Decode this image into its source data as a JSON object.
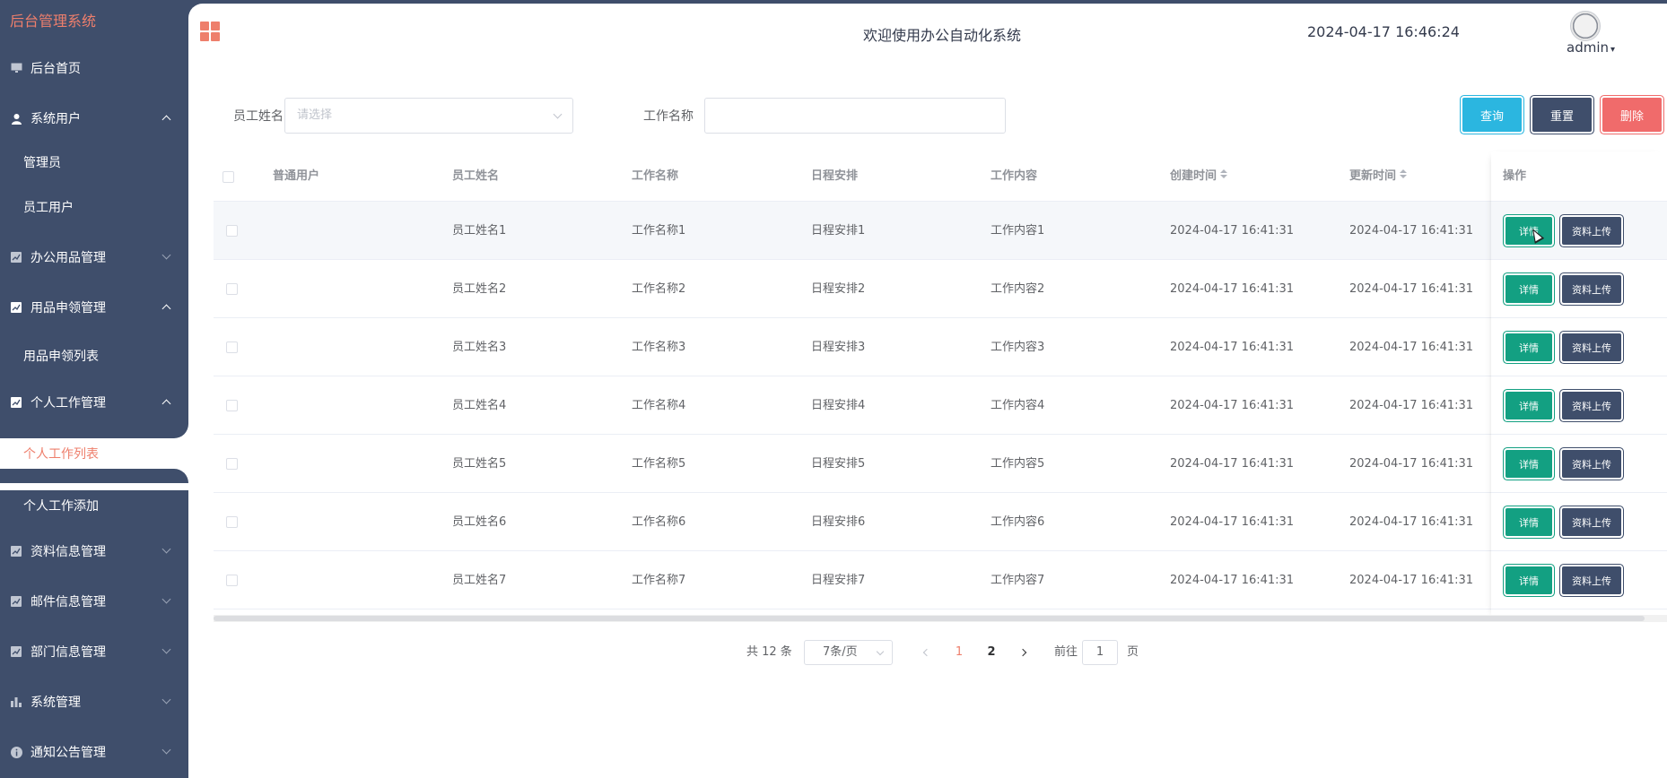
{
  "app": {
    "title": "后台管理系统"
  },
  "sidebar": {
    "items": [
      {
        "label": "后台首页",
        "icon": "monitor-icon"
      },
      {
        "label": "系统用户",
        "icon": "user-icon"
      },
      {
        "label": "管理员"
      },
      {
        "label": "员工用户"
      },
      {
        "label": "办公用品管理",
        "icon": "chart-icon"
      },
      {
        "label": "用品申领管理",
        "icon": "chart-icon"
      },
      {
        "label": "用品申领列表"
      },
      {
        "label": "个人工作管理",
        "icon": "chart-icon"
      },
      {
        "label": "个人工作列表"
      },
      {
        "label": "个人工作添加"
      },
      {
        "label": "资料信息管理",
        "icon": "chart-icon"
      },
      {
        "label": "邮件信息管理",
        "icon": "chart-icon"
      },
      {
        "label": "部门信息管理",
        "icon": "chart-icon"
      },
      {
        "label": "系统管理",
        "icon": "bar-chart-icon"
      },
      {
        "label": "通知公告管理",
        "icon": "info-icon"
      }
    ]
  },
  "header": {
    "welcome": "欢迎使用办公自动化系统",
    "datetime": "2024-04-17 16:46:24",
    "user": "admin"
  },
  "filters": {
    "employee_label": "员工姓名",
    "employee_placeholder": "请选择",
    "work_label": "工作名称",
    "work_value": "",
    "query_button": "查询",
    "reset_button": "重置",
    "delete_button": "删除"
  },
  "table": {
    "headers": [
      "普通用户",
      "员工姓名",
      "工作名称",
      "日程安排",
      "工作内容",
      "创建时间",
      "更新时间",
      "操作"
    ],
    "rows": [
      {
        "user": "",
        "name": "员工姓名1",
        "work": "工作名称1",
        "schedule": "日程安排1",
        "content": "工作内容1",
        "created": "2024-04-17 16:41:31",
        "updated": "2024-04-17 16:41:31"
      },
      {
        "user": "",
        "name": "员工姓名2",
        "work": "工作名称2",
        "schedule": "日程安排2",
        "content": "工作内容2",
        "created": "2024-04-17 16:41:31",
        "updated": "2024-04-17 16:41:31"
      },
      {
        "user": "",
        "name": "员工姓名3",
        "work": "工作名称3",
        "schedule": "日程安排3",
        "content": "工作内容3",
        "created": "2024-04-17 16:41:31",
        "updated": "2024-04-17 16:41:31"
      },
      {
        "user": "",
        "name": "员工姓名4",
        "work": "工作名称4",
        "schedule": "日程安排4",
        "content": "工作内容4",
        "created": "2024-04-17 16:41:31",
        "updated": "2024-04-17 16:41:31"
      },
      {
        "user": "",
        "name": "员工姓名5",
        "work": "工作名称5",
        "schedule": "日程安排5",
        "content": "工作内容5",
        "created": "2024-04-17 16:41:31",
        "updated": "2024-04-17 16:41:31"
      },
      {
        "user": "",
        "name": "员工姓名6",
        "work": "工作名称6",
        "schedule": "日程安排6",
        "content": "工作内容6",
        "created": "2024-04-17 16:41:31",
        "updated": "2024-04-17 16:41:31"
      },
      {
        "user": "",
        "name": "员工姓名7",
        "work": "工作名称7",
        "schedule": "日程安排7",
        "content": "工作内容7",
        "created": "2024-04-17 16:41:31",
        "updated": "2024-04-17 16:41:31"
      }
    ],
    "detail_button": "详情",
    "upload_button": "资料上传"
  },
  "pagination": {
    "total": "共 12 条",
    "page_size": "7条/页",
    "pages": [
      "1",
      "2"
    ],
    "current": "1",
    "goto_prefix": "前往",
    "goto_value": "1",
    "goto_suffix": "页"
  },
  "colors": {
    "sidebar_bg": "#3f4e6b",
    "accent": "#ee7f6c",
    "query": "#2bb6e0",
    "delete": "#f06b6b",
    "detail": "#13a082"
  }
}
